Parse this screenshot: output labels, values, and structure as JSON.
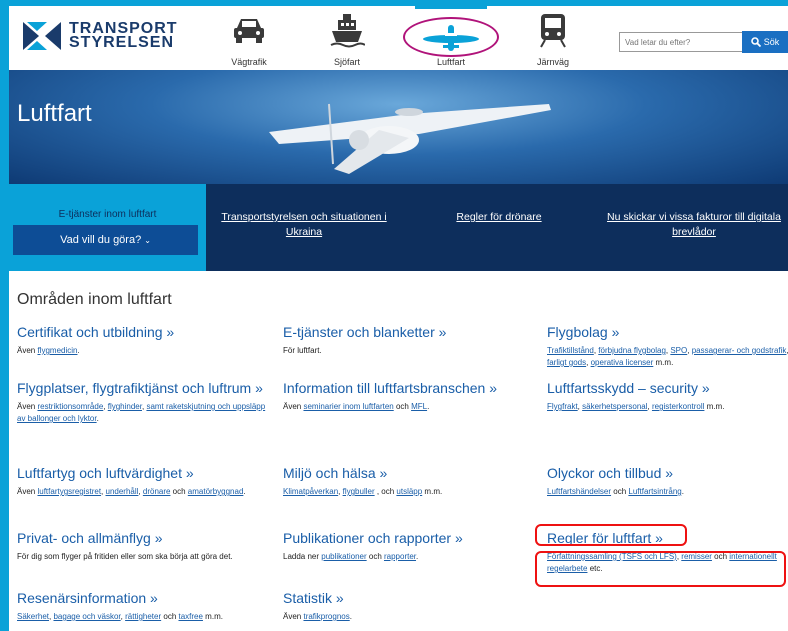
{
  "header": {
    "logo_line1": "TRANSPORT",
    "logo_line2": "STYRELSEN",
    "modes": [
      {
        "label": "Vägtrafik",
        "icon": "car-icon"
      },
      {
        "label": "Sjöfart",
        "icon": "ship-icon"
      },
      {
        "label": "Luftfart",
        "icon": "airplane-icon",
        "active": true
      },
      {
        "label": "Järnväg",
        "icon": "train-icon"
      }
    ],
    "search_placeholder": "Vad letar du efter?",
    "search_button": "Sök"
  },
  "hero": {
    "title": "Luftfart"
  },
  "nav": {
    "etj_title": "E-tjänster inom luftfart",
    "etj_button": "Vad vill du göra?",
    "links": [
      "Transportstyrelsen och situationen i Ukraina",
      "Regler för drönare",
      "Nu skickar vi vissa fakturor till digitala brevlådor"
    ]
  },
  "main": {
    "title": "Områden inom luftfart",
    "areas": [
      {
        "title": "Certifikat och utbildning »",
        "desc": [
          {
            "t": "Även "
          },
          {
            "t": "flygmedicin",
            "link": true
          },
          {
            "t": "."
          }
        ]
      },
      {
        "title": "E-tjänster och blanketter »",
        "desc": [
          {
            "t": "För luftfart."
          }
        ]
      },
      {
        "title": "Flygbolag »",
        "desc": [
          {
            "t": "Trafiktillstånd",
            "link": true
          },
          {
            "t": ", "
          },
          {
            "t": "förbjudna flygbolag",
            "link": true
          },
          {
            "t": ", "
          },
          {
            "t": "SPO",
            "link": true
          },
          {
            "t": ", "
          },
          {
            "t": "passagerar- och godstrafik",
            "link": true
          },
          {
            "t": ", "
          },
          {
            "t": "farligt gods",
            "link": true
          },
          {
            "t": ", "
          },
          {
            "t": "operativa licenser",
            "link": true
          },
          {
            "t": " m.m."
          }
        ]
      },
      {
        "title": "Flygplatser, flygtrafiktjänst och luftrum »",
        "desc": [
          {
            "t": "Även "
          },
          {
            "t": "restriktionsområde",
            "link": true
          },
          {
            "t": ", "
          },
          {
            "t": "flyghinder",
            "link": true
          },
          {
            "t": ", "
          },
          {
            "t": "samt raketskjutning och uppsläpp av ballonger och lyktor",
            "link": true
          },
          {
            "t": "."
          }
        ]
      },
      {
        "title": "Information till luftfartsbranschen »",
        "desc": [
          {
            "t": "Även "
          },
          {
            "t": "seminarier inom luftfarten",
            "link": true
          },
          {
            "t": " och "
          },
          {
            "t": "MFL",
            "link": true
          },
          {
            "t": "."
          }
        ]
      },
      {
        "title": "Luftfartsskydd – security »",
        "desc": [
          {
            "t": "Flygfrakt",
            "link": true
          },
          {
            "t": ", "
          },
          {
            "t": "säkerhetspersonal",
            "link": true
          },
          {
            "t": ", "
          },
          {
            "t": "registerkontroll",
            "link": true
          },
          {
            "t": " m.m."
          }
        ]
      },
      {
        "title": "Luftfartyg och luftvärdighet »",
        "desc": [
          {
            "t": "Även "
          },
          {
            "t": "luftfartygsregistret",
            "link": true
          },
          {
            "t": ", "
          },
          {
            "t": "underhåll",
            "link": true
          },
          {
            "t": ", "
          },
          {
            "t": "drönare",
            "link": true
          },
          {
            "t": " och "
          },
          {
            "t": "amatörbyggnad",
            "link": true
          },
          {
            "t": "."
          }
        ]
      },
      {
        "title": "Miljö och hälsa »",
        "desc": [
          {
            "t": "Klimatpåverkan",
            "link": true
          },
          {
            "t": ", "
          },
          {
            "t": "flygbuller",
            "link": true
          },
          {
            "t": " , och "
          },
          {
            "t": "utsläpp",
            "link": true
          },
          {
            "t": " m.m."
          }
        ]
      },
      {
        "title": "Olyckor och tillbud »",
        "desc": [
          {
            "t": "Luftfartshändelser",
            "link": true
          },
          {
            "t": " och "
          },
          {
            "t": "Luftfartsintrång",
            "link": true
          },
          {
            "t": "."
          }
        ]
      },
      {
        "title": "Privat- och allmänflyg »",
        "desc": [
          {
            "t": "För dig som flyger på fritiden eller som ska börja att göra det."
          }
        ]
      },
      {
        "title": "Publikationer och rapporter »",
        "desc": [
          {
            "t": "Ladda ner "
          },
          {
            "t": "publikationer",
            "link": true
          },
          {
            "t": " och "
          },
          {
            "t": "rapporter",
            "link": true
          },
          {
            "t": "."
          }
        ]
      },
      {
        "title": "Regler för luftfart »",
        "desc": [
          {
            "t": "Författningssamling (TSFS och LFS)",
            "link": true
          },
          {
            "t": ", "
          },
          {
            "t": "remisser",
            "link": true
          },
          {
            "t": " och "
          },
          {
            "t": "internationellt regelarbete",
            "link": true
          },
          {
            "t": " etc."
          }
        ]
      },
      {
        "title": "Resenärsinformation »",
        "desc": [
          {
            "t": "Säkerhet",
            "link": true
          },
          {
            "t": ", "
          },
          {
            "t": "bagage och väskor",
            "link": true
          },
          {
            "t": ", "
          },
          {
            "t": "rättigheter",
            "link": true
          },
          {
            "t": " och "
          },
          {
            "t": "taxfree",
            "link": true
          },
          {
            "t": " m.m."
          }
        ]
      },
      {
        "title": "Statistik »",
        "desc": [
          {
            "t": "Även "
          },
          {
            "t": "trafikprognos",
            "link": true
          },
          {
            "t": "."
          }
        ]
      }
    ]
  },
  "colors": {
    "brand_blue": "#0aa2d8",
    "navy": "#0d2e5c",
    "link": "#1a5ea8",
    "annotation_red": "#e11111",
    "annotation_magenta": "#b0137a"
  }
}
